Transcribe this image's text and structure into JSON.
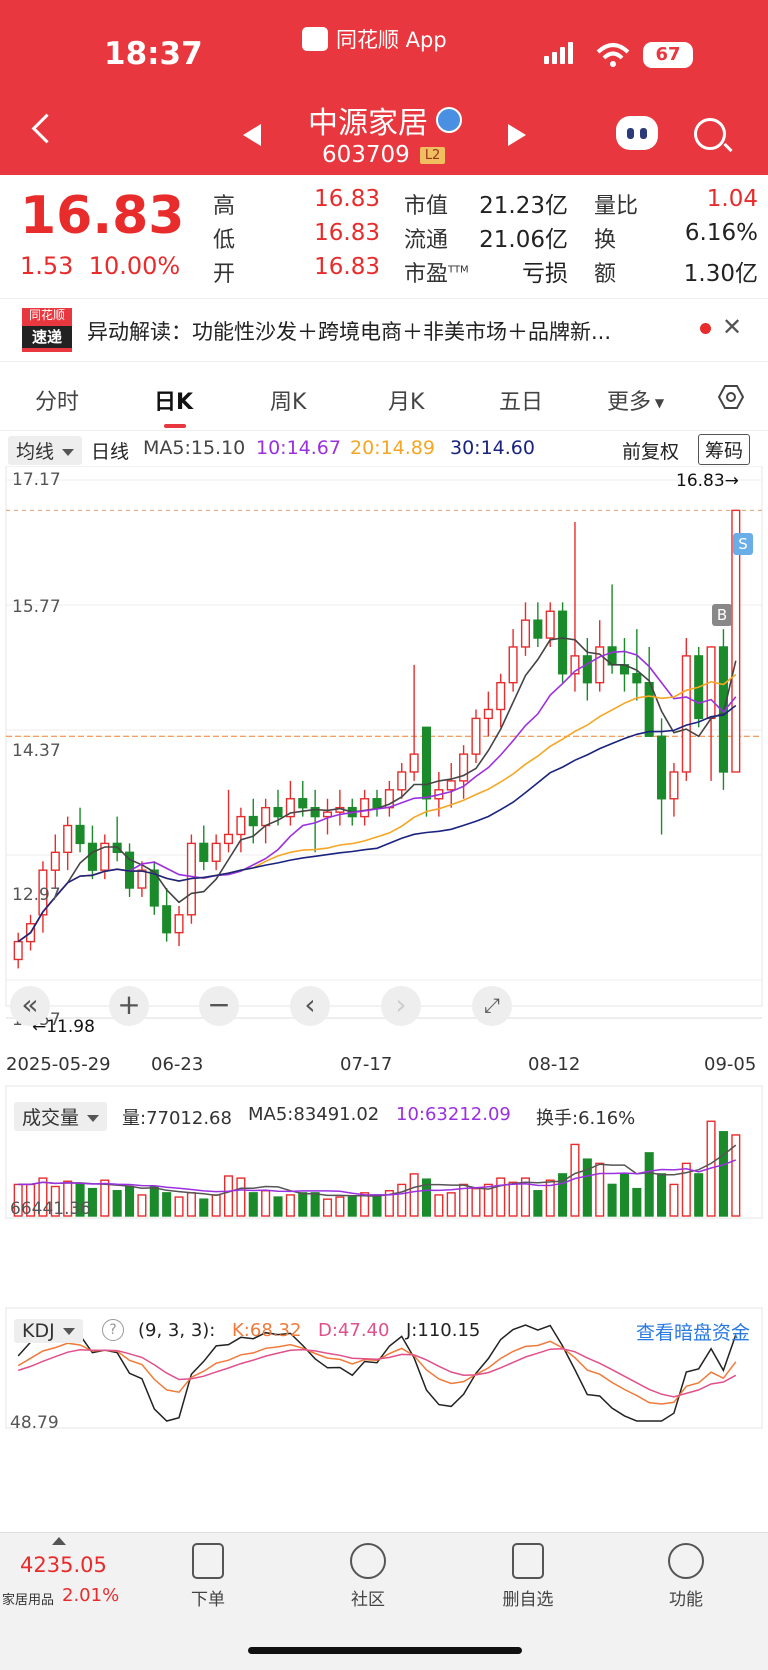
{
  "status_bar": {
    "time": "18:37",
    "app_name": "同花顺 App",
    "battery": "67"
  },
  "stock": {
    "name": "中源家居",
    "code": "603709",
    "level": "L2"
  },
  "quote": {
    "price": "16.83",
    "change": "1.53",
    "change_pct": "10.00%",
    "high_label": "高",
    "high": "16.83",
    "low_label": "低",
    "low": "16.83",
    "open_label": "开",
    "open": "16.83",
    "mcap_label": "市值",
    "mcap": "21.23亿",
    "float_label": "流通",
    "float": "21.06亿",
    "pe_label": "市盈",
    "pe_sup": "TTM",
    "pe": "亏损",
    "vr_label": "量比",
    "vr": "1.04",
    "turn_label": "换",
    "turn": "6.16%",
    "amt_label": "额",
    "amt": "1.30亿"
  },
  "news": {
    "badge_top": "同花顺",
    "badge_bottom": "速递",
    "text": "异动解读：功能性沙发＋跨境电商＋非美市场＋品牌新..."
  },
  "tabs": [
    "分时",
    "日K",
    "周K",
    "月K",
    "五日",
    "更多"
  ],
  "active_tab": "日K",
  "ma_row": {
    "selector": "均线",
    "period": "日线",
    "ma5": "MA5:15.10",
    "ma10": "10:14.67",
    "ma20": "20:14.89",
    "ma30": "30:14.60",
    "adjust": "前复权",
    "chips": "筹码"
  },
  "colors": {
    "up": "#e82b2b",
    "down": "#1a8a2a",
    "ma5": "#444444",
    "ma10": "#9b30e0",
    "ma20": "#f5a623",
    "ma30": "#1a237e",
    "header": "#e8373e",
    "k": "#f07a3a",
    "d": "#e0508a",
    "j": "#222222"
  },
  "price_chart": {
    "y_labels": [
      "17.17",
      "15.77",
      "14.37",
      "12.97",
      "11.57"
    ],
    "high_marker": "16.83→",
    "low_marker": "←11.98",
    "x_labels": [
      "2025-05-29",
      "06-23",
      "07-17",
      "08-12",
      "09-05"
    ],
    "sell_marker": "S",
    "buy_marker": "B"
  },
  "volume_panel": {
    "selector": "成交量",
    "vol": "量:77012.68",
    "ma5": "MA5:83491.02",
    "ma10": "10:63212.09",
    "turnover": "换手:6.16%",
    "y_label": "66441.36"
  },
  "kdj_panel": {
    "selector": "KDJ",
    "help": "?",
    "params": "(9, 3, 3):",
    "k": "K:68.32",
    "d": "D:47.40",
    "j": "J:110.15",
    "link": "查看暗盘资金",
    "y_label": "48.79"
  },
  "chart_data": {
    "type": "candlestick",
    "ohlc": [
      [
        11.8,
        12.1,
        11.7,
        12.0
      ],
      [
        12.0,
        12.3,
        11.9,
        12.2
      ],
      [
        12.3,
        12.9,
        12.1,
        12.8
      ],
      [
        12.8,
        13.2,
        12.6,
        13.0
      ],
      [
        13.0,
        13.4,
        12.8,
        13.3
      ],
      [
        13.3,
        13.5,
        13.0,
        13.1
      ],
      [
        13.1,
        13.3,
        12.7,
        12.8
      ],
      [
        12.8,
        13.2,
        12.7,
        13.1
      ],
      [
        13.1,
        13.4,
        12.9,
        13.0
      ],
      [
        13.0,
        13.1,
        12.5,
        12.6
      ],
      [
        12.6,
        12.9,
        12.5,
        12.8
      ],
      [
        12.8,
        12.9,
        12.3,
        12.4
      ],
      [
        12.4,
        12.6,
        12.0,
        12.1
      ],
      [
        12.1,
        12.4,
        11.95,
        12.3
      ],
      [
        12.3,
        13.2,
        12.2,
        13.1
      ],
      [
        13.1,
        13.3,
        12.8,
        12.9
      ],
      [
        12.9,
        13.2,
        12.8,
        13.1
      ],
      [
        13.1,
        13.7,
        13.0,
        13.2
      ],
      [
        13.2,
        13.5,
        13.0,
        13.4
      ],
      [
        13.4,
        13.6,
        13.1,
        13.3
      ],
      [
        13.3,
        13.6,
        13.1,
        13.5
      ],
      [
        13.5,
        13.7,
        13.3,
        13.4
      ],
      [
        13.4,
        13.8,
        13.3,
        13.6
      ],
      [
        13.6,
        13.8,
        13.4,
        13.5
      ],
      [
        13.5,
        13.7,
        13.0,
        13.4
      ],
      [
        13.4,
        13.6,
        13.2,
        13.45
      ],
      [
        13.45,
        13.7,
        13.3,
        13.5
      ],
      [
        13.5,
        13.6,
        13.3,
        13.4
      ],
      [
        13.4,
        13.7,
        13.3,
        13.6
      ],
      [
        13.6,
        13.7,
        13.4,
        13.5
      ],
      [
        13.5,
        13.8,
        13.4,
        13.7
      ],
      [
        13.7,
        14.0,
        13.6,
        13.9
      ],
      [
        13.9,
        15.1,
        13.8,
        14.1
      ],
      [
        14.4,
        14.4,
        13.4,
        13.6
      ],
      [
        13.6,
        13.9,
        13.4,
        13.7
      ],
      [
        13.7,
        14.0,
        13.5,
        13.8
      ],
      [
        13.8,
        14.2,
        13.6,
        14.1
      ],
      [
        14.1,
        14.6,
        14.0,
        14.5
      ],
      [
        14.5,
        14.8,
        14.3,
        14.6
      ],
      [
        14.6,
        15.0,
        14.4,
        14.9
      ],
      [
        14.9,
        15.5,
        14.8,
        15.3
      ],
      [
        15.3,
        15.8,
        15.2,
        15.6
      ],
      [
        15.6,
        15.8,
        15.3,
        15.4
      ],
      [
        15.4,
        15.8,
        15.3,
        15.7
      ],
      [
        15.7,
        15.8,
        14.9,
        15.0
      ],
      [
        15.0,
        16.7,
        14.8,
        15.2
      ],
      [
        15.2,
        15.4,
        14.7,
        14.9
      ],
      [
        14.9,
        15.6,
        14.8,
        15.3
      ],
      [
        15.3,
        16.0,
        15.0,
        15.1
      ],
      [
        15.1,
        15.4,
        14.8,
        15.0
      ],
      [
        15.0,
        15.5,
        14.7,
        14.9
      ],
      [
        14.9,
        15.3,
        14.3,
        14.3
      ],
      [
        14.3,
        14.5,
        13.2,
        13.6
      ],
      [
        13.6,
        14.0,
        13.4,
        13.9
      ],
      [
        13.9,
        15.4,
        13.8,
        15.2
      ],
      [
        15.2,
        15.3,
        14.4,
        14.5
      ],
      [
        14.5,
        15.3,
        13.8,
        15.3
      ],
      [
        15.3,
        15.5,
        13.7,
        13.9
      ],
      [
        13.9,
        16.83,
        13.9,
        16.83
      ]
    ],
    "volumes": [
      30,
      30,
      36,
      28,
      33,
      30,
      26,
      34,
      24,
      28,
      20,
      28,
      22,
      18,
      22,
      16,
      20,
      38,
      36,
      22,
      24,
      18,
      20,
      22,
      22,
      16,
      18,
      18,
      22,
      20,
      24,
      30,
      40,
      35,
      20,
      22,
      30,
      26,
      30,
      36,
      32,
      36,
      24,
      34,
      40,
      68,
      54,
      50,
      30,
      40,
      26,
      60,
      40,
      30,
      50,
      40,
      90,
      80,
      77
    ]
  }
}
